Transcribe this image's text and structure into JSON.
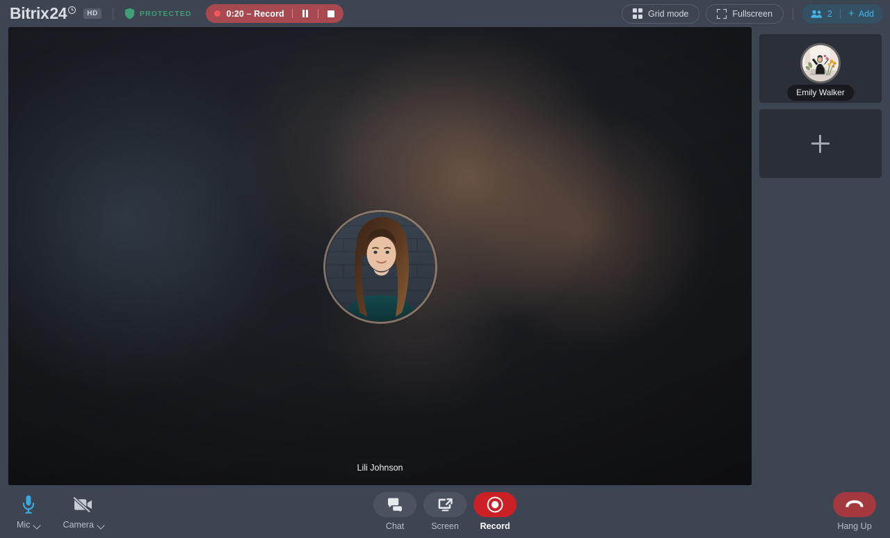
{
  "app": {
    "brand_first": "Bitrix",
    "brand_second": "24",
    "quality_badge": "HD",
    "protected_label": "PROTECTED",
    "accent_blue": "#45b2e8",
    "accent_green": "#3f9e73",
    "accent_red": "#cc2027",
    "bg": "#3d4452"
  },
  "recording": {
    "timer": "0:20",
    "separator": "–",
    "label": "Record",
    "full_text": "0:20 – Record",
    "pause_icon": "pause-icon",
    "stop_icon": "stop-icon",
    "dot_icon": "recording-dot-icon"
  },
  "topbar": {
    "grid_mode": "Grid mode",
    "fullscreen": "Fullscreen",
    "grid_icon": "grid-icon",
    "fullscreen_icon": "expand-icon",
    "participants_icon": "people-icon",
    "participants_count": "2",
    "add_plus": "+",
    "add_label": "Add"
  },
  "stage": {
    "speaker_name": "Lili Johnson",
    "avatar_alt": "lili-johnson-avatar"
  },
  "rail": {
    "tiles": [
      {
        "name": "Emily Walker",
        "type": "participant",
        "avatar_alt": "emily-walker-avatar"
      },
      {
        "name": "+",
        "type": "add",
        "icon": "plus-icon"
      }
    ]
  },
  "toolbar": {
    "mic": {
      "label": "Mic",
      "icon": "microphone-icon",
      "state": "on"
    },
    "camera": {
      "label": "Camera",
      "icon": "camera-off-icon",
      "state": "off"
    },
    "chat": {
      "label": "Chat",
      "icon": "chat-bubbles-icon"
    },
    "screen": {
      "label": "Screen",
      "icon": "screen-share-icon"
    },
    "record": {
      "label": "Record",
      "icon": "record-circle-icon",
      "state": "active"
    },
    "hangup": {
      "label": "Hang Up",
      "icon": "phone-hangup-icon"
    }
  }
}
